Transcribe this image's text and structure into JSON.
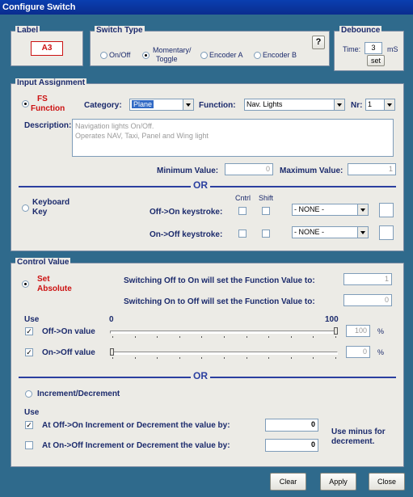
{
  "window": {
    "title": "Configure Switch"
  },
  "label_group": {
    "title": "Label",
    "value": "A3"
  },
  "switch_type": {
    "title": "Switch Type",
    "help": "?",
    "options": [
      "On/Off",
      "Momentary/",
      "Toggle",
      "Encoder A",
      "Encoder B"
    ],
    "selected": "Momentary/Toggle"
  },
  "debounce": {
    "title": "Debounce",
    "time_label": "Time:",
    "time_value": "3",
    "unit": "mS",
    "set_label": "set"
  },
  "input_assignment": {
    "title": "Input Assignment",
    "fs_label_1": "FS",
    "fs_label_2": "Function",
    "category_label": "Category:",
    "category_value": "Plane",
    "function_label": "Function:",
    "function_value": "Nav. Lights",
    "nr_label": "Nr:",
    "nr_value": "1",
    "description_label": "Description:",
    "description_line1": "Navigation lights On/Off.",
    "description_line2": "Operates NAV, Taxi, Panel and Wing light",
    "min_label": "Minimum Value:",
    "min_value": "0",
    "max_label": "Maximum Value:",
    "max_value": "1",
    "or_label": "OR",
    "keyboard_label_1": "Keyboard",
    "keyboard_label_2": "Key",
    "cntrl_label": "Cntrl",
    "shift_label": "Shift",
    "off_on_keystroke_label": "Off->On keystroke:",
    "on_off_keystroke_label": "On->Off keystroke:",
    "off_on_key_value": "- NONE -",
    "on_off_key_value": "- NONE -"
  },
  "control_value": {
    "title": "Control Value",
    "set_label_1": "Set",
    "set_label_2": "Absolute",
    "off_on_set_label": "Switching Off to On will set the Function Value to:",
    "off_on_set_value": "1",
    "on_off_set_label": "Switching On to Off will set the Function Value to:",
    "on_off_set_value": "0",
    "use_label": "Use",
    "scale_min": "0",
    "scale_max": "100",
    "off_on_value_label": "Off->On value",
    "off_on_value": "100",
    "off_on_slider_fraction": 1.0,
    "on_off_value_label": "On->Off value",
    "on_off_value": "0",
    "on_off_slider_fraction": 0.0,
    "percent": "%",
    "or_label": "OR",
    "increment_label": "Increment/Decrement",
    "use_label_2": "Use",
    "inc_off_on_label": "At Off->On Increment or Decrement the value by:",
    "inc_off_on_value": "0",
    "inc_on_off_label": "At On->Off Increment or Decrement the value by:",
    "inc_on_off_value": "0",
    "minus_note_1": "Use minus for",
    "minus_note_2": "decrement."
  },
  "buttons": {
    "clear": "Clear",
    "apply": "Apply",
    "close": "Close"
  },
  "colors": {
    "title_bar": "#0a3fb0",
    "background": "#2f6a8c",
    "panel": "#ecebe6",
    "label_text": "#1b2a6c",
    "accent_red": "#cc1111"
  }
}
